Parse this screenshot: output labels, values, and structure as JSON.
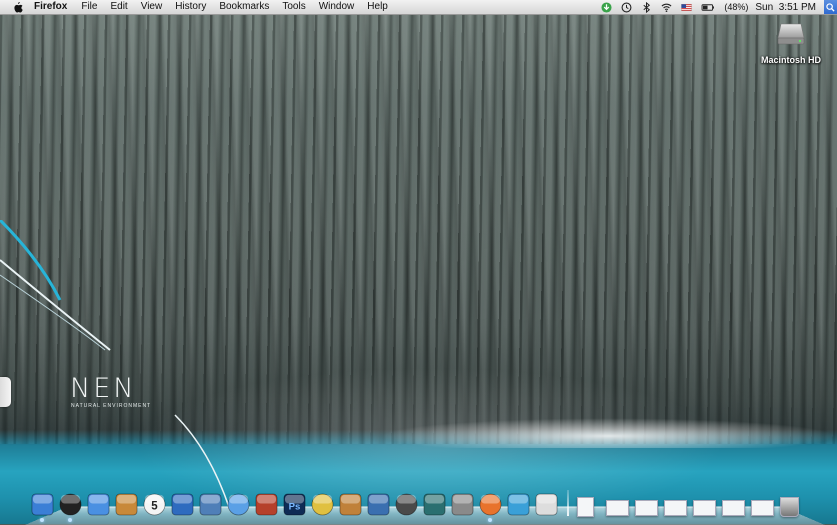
{
  "menubar": {
    "app_name": "Firefox",
    "menus": [
      "File",
      "Edit",
      "View",
      "History",
      "Bookmarks",
      "Tools",
      "Window",
      "Help"
    ],
    "status_icons": [
      "download-status-icon",
      "time-machine-icon",
      "bluetooth-icon",
      "wifi-icon",
      "us-flag-input-icon",
      "battery-icon"
    ],
    "battery_percent": "(48%)",
    "clock": {
      "day": "Sun",
      "time": "3:51 PM"
    }
  },
  "desktop": {
    "drive_label": "Macintosh HD",
    "wallpaper_title": "NEN",
    "wallpaper_subtitle": "NATURAL ENVIRONMENT"
  },
  "dock": {
    "apps": [
      {
        "name": "finder-icon",
        "color": "#3b7fd6"
      },
      {
        "name": "dashboard-icon",
        "color": "#222222"
      },
      {
        "name": "safari-icon",
        "color": "#4a90e2"
      },
      {
        "name": "address-book-icon",
        "color": "#c8893a"
      },
      {
        "name": "ical-icon",
        "color": "#d23232",
        "label": "5"
      },
      {
        "name": "thunderbird-icon",
        "color": "#2e6bbf"
      },
      {
        "name": "iphoto-icon",
        "color": "#4f7fb8"
      },
      {
        "name": "itunes-icon",
        "color": "#5aa0e6"
      },
      {
        "name": "photo-booth-icon",
        "color": "#b5402b"
      },
      {
        "name": "photoshop-icon",
        "color": "#0f2b55",
        "label": "Ps"
      },
      {
        "name": "imovie-icon",
        "color": "#e0c040"
      },
      {
        "name": "garageband-icon",
        "color": "#c0813a"
      },
      {
        "name": "textedit-icon",
        "color": "#3a6fb0"
      },
      {
        "name": "spaces-icon",
        "color": "#4a4a4a"
      },
      {
        "name": "time-machine-icon",
        "color": "#2a6f70"
      },
      {
        "name": "system-preferences-icon",
        "color": "#8a8a8a"
      },
      {
        "name": "firefox-icon",
        "color": "#e8732c"
      },
      {
        "name": "messenger-icon",
        "color": "#3aa0d8"
      },
      {
        "name": "script-editor-icon",
        "color": "#dddddd"
      }
    ],
    "documents": [
      "document-stack-icon",
      "minimized-window-icon",
      "minimized-window-icon",
      "minimized-window-icon",
      "minimized-window-icon",
      "minimized-window-icon",
      "minimized-window-icon",
      "trash-icon"
    ]
  }
}
